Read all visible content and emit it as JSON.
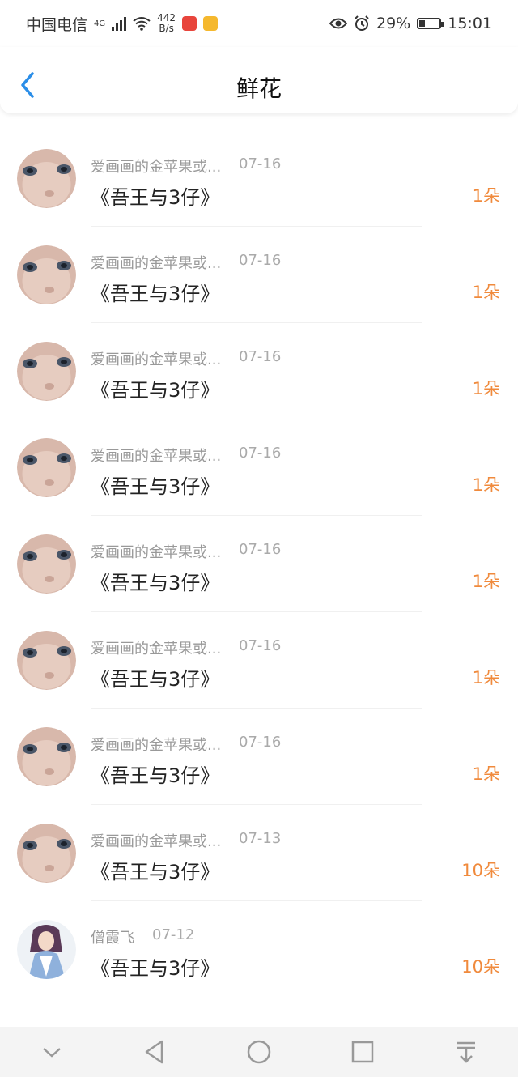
{
  "status_bar": {
    "carrier": "中国电信",
    "network_type": "4G",
    "speed_value": "442",
    "speed_unit": "B/s",
    "battery": "29%",
    "battery_level": 0.29,
    "time": "15:01"
  },
  "header": {
    "title": "鲜花",
    "back_icon": "chevron-left-icon"
  },
  "colors": {
    "accent_blue": "#2b8ee8",
    "count_orange": "#f08a3c"
  },
  "items": [
    {
      "name": "爱画画的金苹果或...",
      "date": "07-16",
      "book": "《吾王与3仔》",
      "count": "1朵",
      "avatar": "face"
    },
    {
      "name": "爱画画的金苹果或...",
      "date": "07-16",
      "book": "《吾王与3仔》",
      "count": "1朵",
      "avatar": "face"
    },
    {
      "name": "爱画画的金苹果或...",
      "date": "07-16",
      "book": "《吾王与3仔》",
      "count": "1朵",
      "avatar": "face"
    },
    {
      "name": "爱画画的金苹果或...",
      "date": "07-16",
      "book": "《吾王与3仔》",
      "count": "1朵",
      "avatar": "face"
    },
    {
      "name": "爱画画的金苹果或...",
      "date": "07-16",
      "book": "《吾王与3仔》",
      "count": "1朵",
      "avatar": "face"
    },
    {
      "name": "爱画画的金苹果或...",
      "date": "07-16",
      "book": "《吾王与3仔》",
      "count": "1朵",
      "avatar": "face"
    },
    {
      "name": "爱画画的金苹果或...",
      "date": "07-16",
      "book": "《吾王与3仔》",
      "count": "1朵",
      "avatar": "face"
    },
    {
      "name": "爱画画的金苹果或...",
      "date": "07-13",
      "book": "《吾王与3仔》",
      "count": "10朵",
      "avatar": "face"
    },
    {
      "name": "僧霞飞",
      "date": "07-12",
      "book": "《吾王与3仔》",
      "count": "10朵",
      "avatar": "anime"
    }
  ],
  "nav": [
    "chevron-down-icon",
    "back-triangle-icon",
    "home-circle-icon",
    "recents-square-icon",
    "pull-down-icon"
  ]
}
